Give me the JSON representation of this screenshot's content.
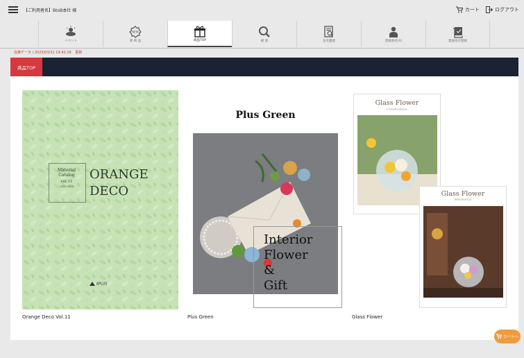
{
  "topbar": {
    "user_label": "【ご利用者名】BtoB本社 様",
    "cart_label": "カート",
    "logout_label": "ログアウト"
  },
  "nav": {
    "items": [
      {
        "label": "イベント",
        "icon": "event-icon"
      },
      {
        "label": "新 商 品",
        "icon": "new-product-icon"
      },
      {
        "label": "商品TOP",
        "icon": "gift-icon"
      },
      {
        "label": "検 索",
        "icon": "search-icon"
      },
      {
        "label": "注文履歴",
        "icon": "order-history-icon"
      },
      {
        "label": "登録会社(0)",
        "icon": "user-icon"
      },
      {
        "label": "発送先の登録",
        "icon": "address-book-icon"
      }
    ],
    "active_index": 2
  },
  "status": {
    "inventory_label": "在庫データ / 2023/03/31 19:42:18",
    "update_link": "更新"
  },
  "header": {
    "tab_label": "商品TOP"
  },
  "catalogs": [
    {
      "title": "Orange Deco Vol.11",
      "cover": {
        "small_lines": [
          "Material",
          "Catalog"
        ],
        "vol": "vol.11",
        "year": "2023-2023",
        "big_lines": [
          "ORANGE",
          "DECO"
        ],
        "brand": "APLUS"
      }
    },
    {
      "title": "Plus Green",
      "cover": {
        "heading": "Plus Green",
        "lines": [
          "Interior",
          "Flower",
          "&",
          "Gift"
        ]
      }
    },
    {
      "title": "Glass Flower",
      "cover": {
        "book1_title": "Glass Flower",
        "book1_sub": "Celebration",
        "book2_title": "Glass Flower",
        "book2_sub": "Memorial"
      }
    }
  ],
  "floating_cart": {
    "label": "カートへ"
  },
  "colors": {
    "accent_red": "#d6383f",
    "header_dark": "#1a2233",
    "cart_orange": "#ef9b3f",
    "status_red": "#c0392b"
  }
}
